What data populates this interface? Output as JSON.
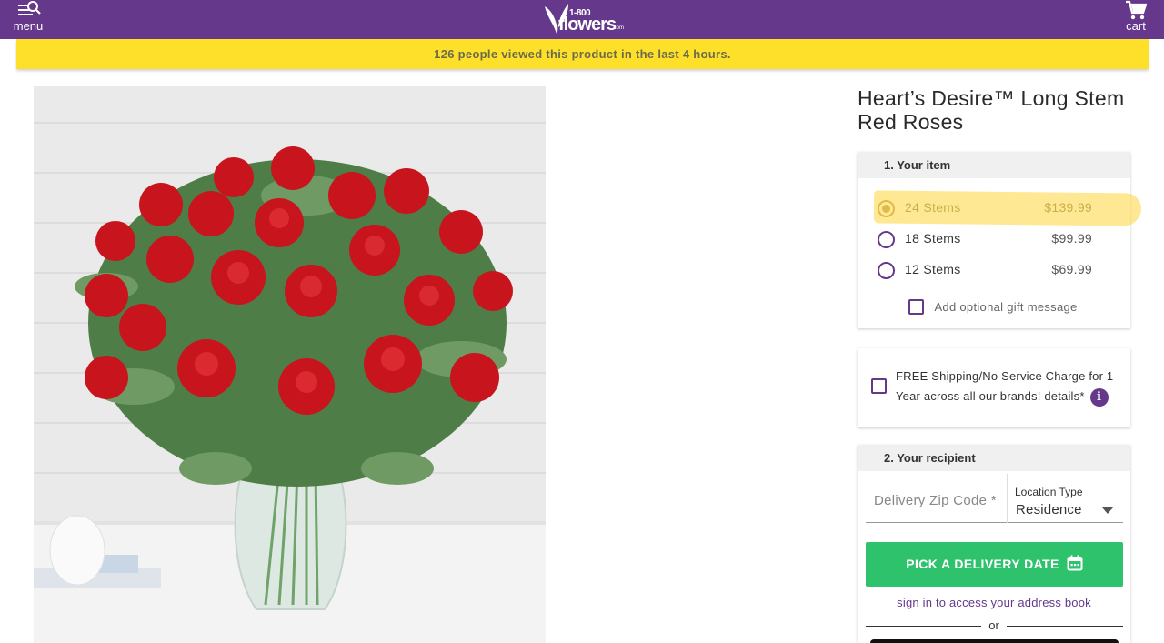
{
  "header": {
    "menu_label": "menu",
    "menu_icon": "menu-search-icon",
    "logo_top": "1-800",
    "logo_word": "flowers",
    "logo_suffix": ".com",
    "cart_label": "cart",
    "cart_icon": "shopping-cart-icon",
    "bar_color": "#65388b"
  },
  "banner": {
    "text": "126 people viewed this product in the last 4 hours.",
    "color": "#fee02a"
  },
  "product": {
    "title": "Heart’s Desire™ Long Stem Red Roses",
    "image_alt": "red roses in glass vase"
  },
  "item_section": {
    "heading": "1. Your item",
    "options": [
      {
        "label": "24 Stems",
        "price": "$139.99",
        "selected": true
      },
      {
        "label": "18 Stems",
        "price": "$99.99",
        "selected": false
      },
      {
        "label": "12 Stems",
        "price": "$69.99",
        "selected": false
      }
    ],
    "gift_message_label": "Add optional gift message"
  },
  "shipping": {
    "text": "FREE Shipping/No Service Charge for 1 Year across all our brands! details*",
    "info_icon": "i"
  },
  "recipient": {
    "heading": "2. Your recipient",
    "zip_placeholder": "Delivery Zip Code *",
    "location_label": "Location Type",
    "location_value": "Residence",
    "date_button": "PICK A DELIVERY DATE",
    "signin_link": "sign in to access your address book",
    "or_text": "or"
  },
  "colors": {
    "accent": "#65388b",
    "cta_green": "#2ec26d"
  }
}
